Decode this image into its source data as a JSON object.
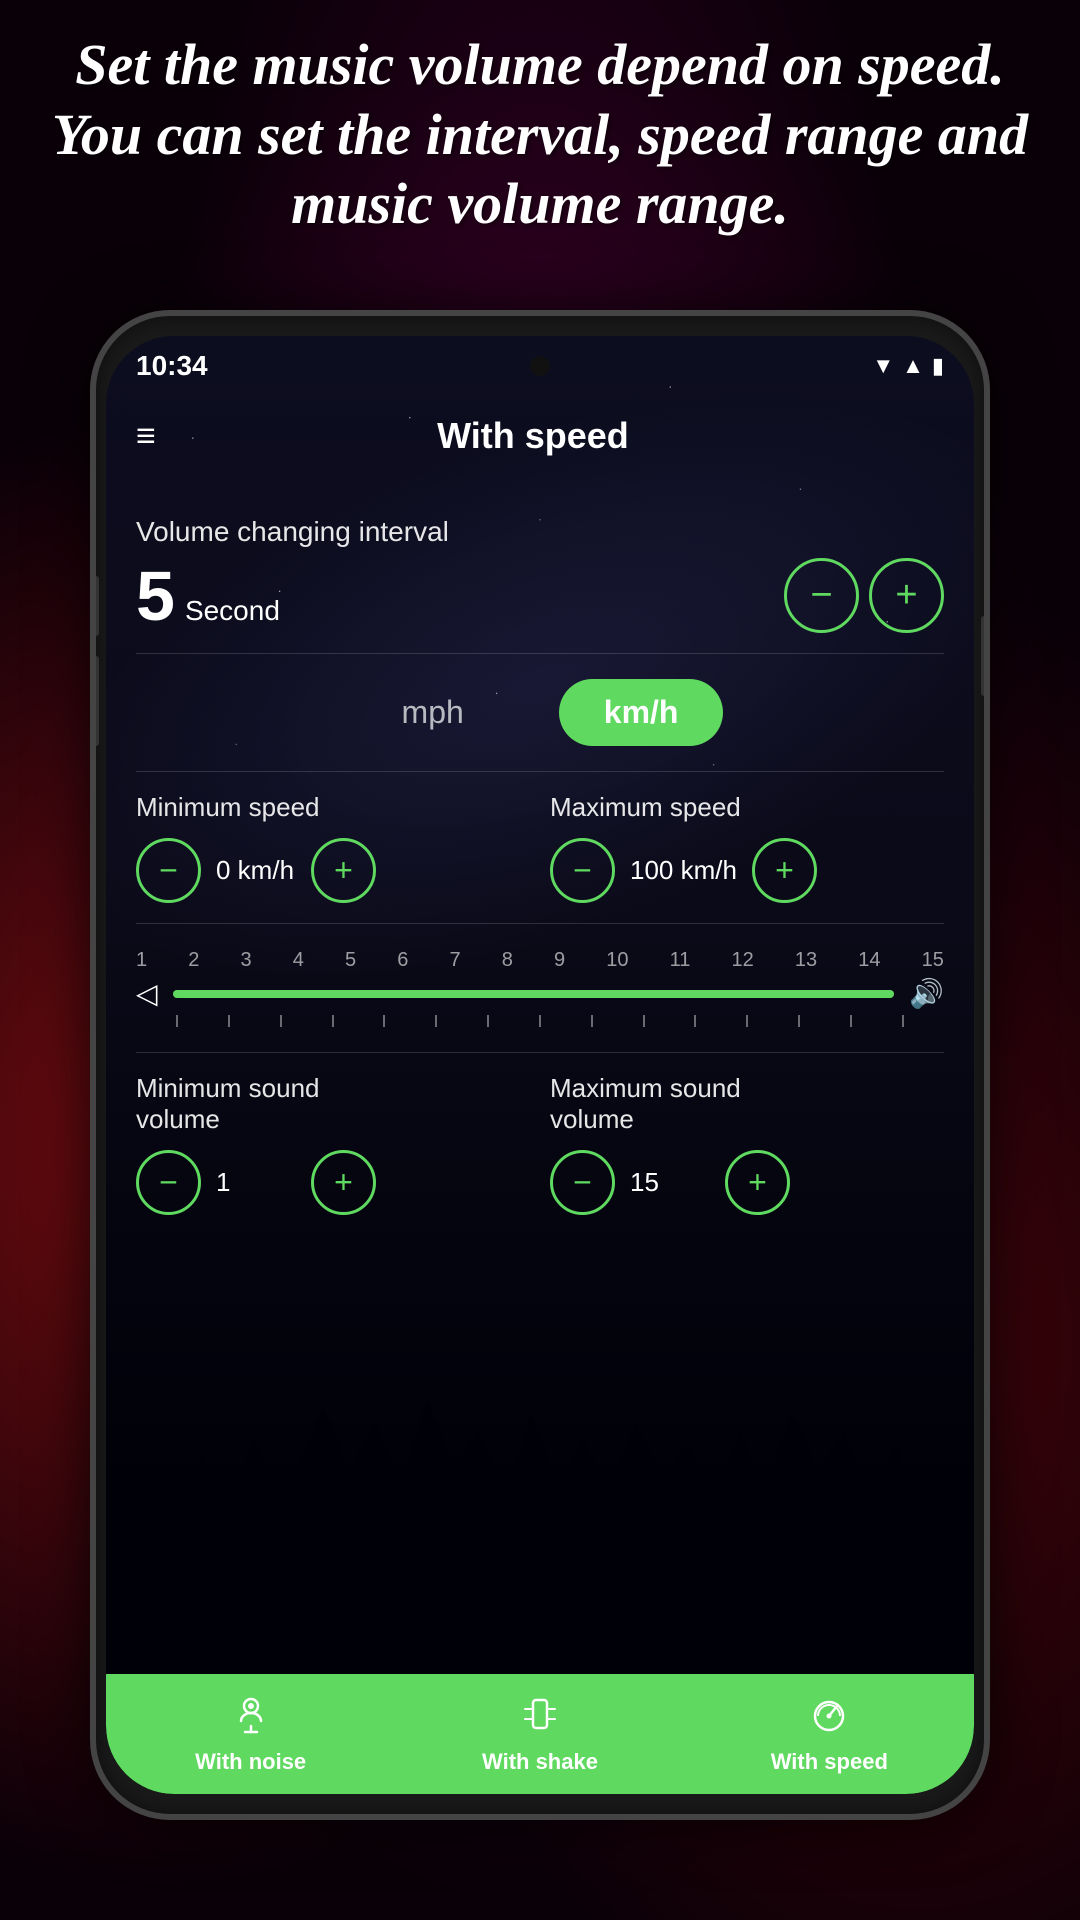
{
  "headline": {
    "text": "Set the music volume depend on speed. You can set the interval, speed range and music volume range."
  },
  "phone": {
    "status_bar": {
      "time": "10:34",
      "wifi_icon": "▼",
      "signal_icon": "▲",
      "battery_icon": "🔋"
    },
    "top_bar": {
      "title": "With speed",
      "menu_icon": "≡"
    },
    "content": {
      "interval_section": {
        "label": "Volume changing interval",
        "value": "5",
        "unit": "Second",
        "minus_label": "−",
        "plus_label": "+"
      },
      "speed_unit": {
        "mph_label": "mph",
        "kmh_label": "km/h",
        "active": "kmh"
      },
      "min_speed": {
        "label": "Minimum speed",
        "value": "0 km/h",
        "minus_label": "−",
        "plus_label": "+"
      },
      "max_speed": {
        "label": "Maximum speed",
        "value": "100 km/h",
        "minus_label": "−",
        "plus_label": "+"
      },
      "volume_slider": {
        "tick_labels": [
          "1",
          "2",
          "3",
          "4",
          "5",
          "6",
          "7",
          "8",
          "9",
          "10",
          "11",
          "12",
          "13",
          "14",
          "15"
        ],
        "fill_percent": 100
      },
      "min_sound": {
        "label": "Minimum sound\nvolume",
        "label_line1": "Minimum sound",
        "label_line2": "volume",
        "value": "1",
        "minus_label": "−",
        "plus_label": "+"
      },
      "max_sound": {
        "label": "Maximum sound\nvolume",
        "label_line1": "Maximum sound",
        "label_line2": "volume",
        "value": "15",
        "minus_label": "−",
        "plus_label": "+"
      }
    },
    "bottom_nav": {
      "items": [
        {
          "id": "with-noise",
          "label": "With noise",
          "icon": "🎙"
        },
        {
          "id": "with-shake",
          "label": "With shake",
          "icon": "📳"
        },
        {
          "id": "with-speed",
          "label": "With speed",
          "icon": "⏱"
        }
      ]
    }
  }
}
